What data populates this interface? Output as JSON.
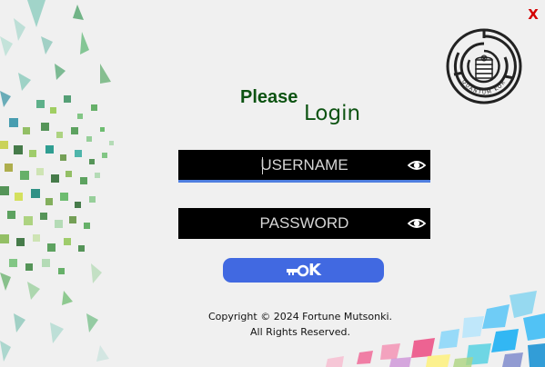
{
  "window": {
    "close_label": "X",
    "brand_color": "#0d5312",
    "accent_color": "#4169e1"
  },
  "logo": {
    "text": "QUANTUM KOR",
    "icon": "coin-maze-logo"
  },
  "heading": {
    "please": "Please",
    "login": "Login"
  },
  "form": {
    "username_placeholder": "USERNAME",
    "username_value": "",
    "password_placeholder": "PASSWORD",
    "password_value": "",
    "show_icon": "eye-icon",
    "ok_label": "K",
    "ok_icon": "key-icon"
  },
  "footer": {
    "copyright": "Copyright © 2024 Fortune Mutsonki.",
    "rights": "All Rights Reserved."
  }
}
